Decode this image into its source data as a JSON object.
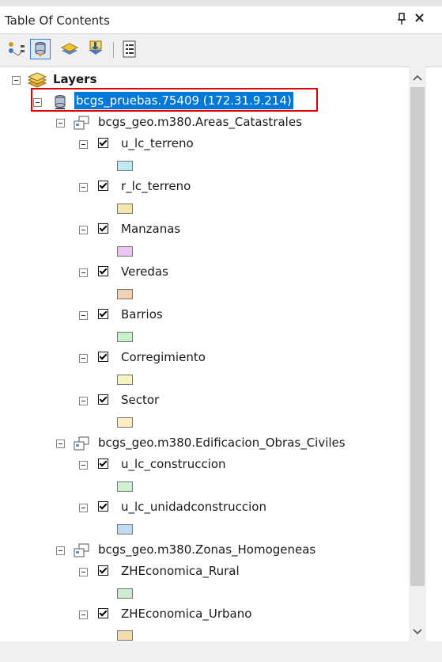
{
  "window": {
    "title": "Table Of Contents",
    "pin_glyph": "↑",
    "close_glyph": "✕"
  },
  "toolbar": {
    "buttons": [
      {
        "name": "list-by-drawing-order-icon"
      },
      {
        "name": "list-by-source-icon",
        "active": true
      },
      {
        "name": "list-by-visibility-icon"
      },
      {
        "name": "list-by-selection-icon"
      },
      {
        "name": "options-icon"
      }
    ]
  },
  "tree": {
    "root": {
      "label": "Layers"
    },
    "database": {
      "label": "bcgs_pruebas.75409 (172.31.9.214)"
    },
    "datasets": [
      {
        "label": "bcgs_geo.m380.Areas_Catastrales",
        "layers": [
          {
            "label": "u_lc_terreno",
            "checked": true,
            "color": "#bfe9f3"
          },
          {
            "label": "r_lc_terreno",
            "checked": true,
            "color": "#f5e6b0"
          },
          {
            "label": "Manzanas",
            "checked": true,
            "color": "#ecc6f2"
          },
          {
            "label": "Veredas",
            "checked": true,
            "color": "#f2d2b4"
          },
          {
            "label": "Barrios",
            "checked": true,
            "color": "#c7f0c7"
          },
          {
            "label": "Corregimiento",
            "checked": true,
            "color": "#f7f3c0"
          },
          {
            "label": "Sector",
            "checked": true,
            "color": "#f7efc0"
          }
        ]
      },
      {
        "label": "bcgs_geo.m380.Edificacion_Obras_Civiles",
        "layers": [
          {
            "label": "u_lc_construccion",
            "checked": true,
            "color": "#cef2d2"
          },
          {
            "label": "u_lc_unidadconstruccion",
            "checked": true,
            "color": "#bfdcf1"
          }
        ]
      },
      {
        "label": "bcgs_geo.m380.Zonas_Homogeneas",
        "layers": [
          {
            "label": "ZHEconomica_Rural",
            "checked": true,
            "color": "#cdebd0"
          },
          {
            "label": "ZHEconomica_Urbano",
            "checked": true,
            "color": "#f5dbb0"
          }
        ]
      }
    ]
  },
  "colors": {
    "selection": "#0078d7",
    "highlight_box": "#e00000"
  }
}
